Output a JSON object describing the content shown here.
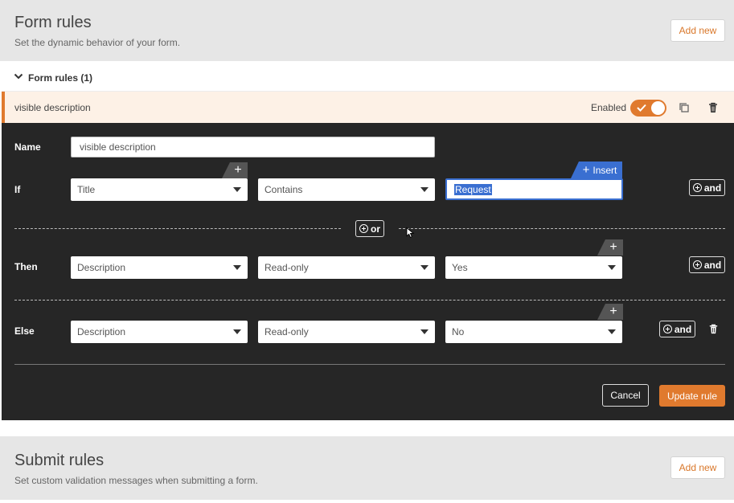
{
  "form_rules": {
    "title": "Form rules",
    "subtitle": "Set the dynamic behavior of your form.",
    "add_label": "Add new",
    "collapse_label": "Form rules (1)"
  },
  "rule": {
    "name": "visible description",
    "enabled_label": "Enabled",
    "enabled": true
  },
  "editor": {
    "name_label": "Name",
    "name_value": "visible description",
    "if_label": "If",
    "then_label": "Then",
    "else_label": "Else",
    "plus": "+",
    "insert_label": "Insert",
    "or_label": "or",
    "and_label": "and",
    "if_row": {
      "field": "Title",
      "operator": "Contains",
      "value": "Request"
    },
    "then_row": {
      "field": "Description",
      "action": "Read-only",
      "value": "Yes"
    },
    "else_row": {
      "field": "Description",
      "action": "Read-only",
      "value": "No"
    },
    "cancel_label": "Cancel",
    "update_label": "Update rule"
  },
  "submit_rules": {
    "title": "Submit rules",
    "subtitle": "Set custom validation messages when submitting a form.",
    "add_label": "Add new"
  },
  "colors": {
    "accent": "#e07a2e",
    "focus": "#3a6fd1",
    "editor_bg": "#262626"
  }
}
